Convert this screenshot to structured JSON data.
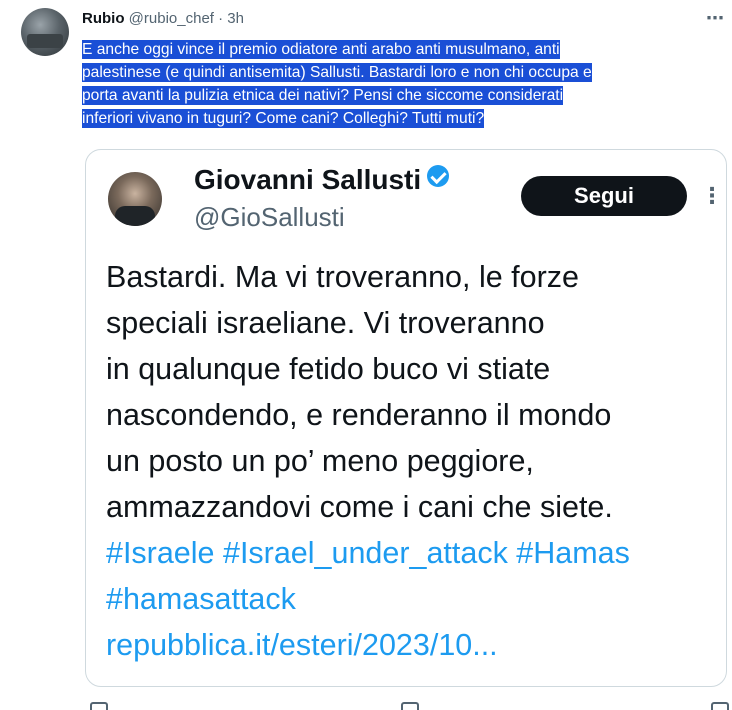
{
  "tweet": {
    "author_name": "Rubio",
    "author_handle": "@rubio_chef",
    "separator": "·",
    "time": "3h",
    "text_lines": [
      "E anche oggi vince il premio odiatore anti arabo anti musulmano, anti",
      "palestinese (e quindi antisemita) Sallusti. Bastardi loro e non chi occupa e",
      "porta avanti la pulizia etnica dei nativi? Pensi che siccome considerati",
      "inferiori vivano in tuguri? Come cani? Colleghi? Tutti muti?"
    ],
    "more_icon": "⋯"
  },
  "quoted": {
    "name": "Giovanni Sallusti",
    "handle": "@GioSallusti",
    "follow_label": "Segui",
    "more_icon": "⋮",
    "body_lines": [
      "Bastardi. Ma vi troveranno, le forze",
      "speciali israeliane. Vi troveranno",
      "in qualunque fetido buco vi stiate",
      "nascondendo, e renderanno il mondo",
      "un posto un po’ meno peggiore,",
      "ammazzandovi come i cani che siete."
    ],
    "link_lines": [
      "#Israele #Israel_under_attack #Hamas",
      "#hamasattack",
      "repubblica.it/esteri/2023/10..."
    ]
  },
  "colors": {
    "selection_highlight": "#1a4fd6",
    "link": "#1d9bf0",
    "text": "#0f1419",
    "muted": "#536471"
  }
}
